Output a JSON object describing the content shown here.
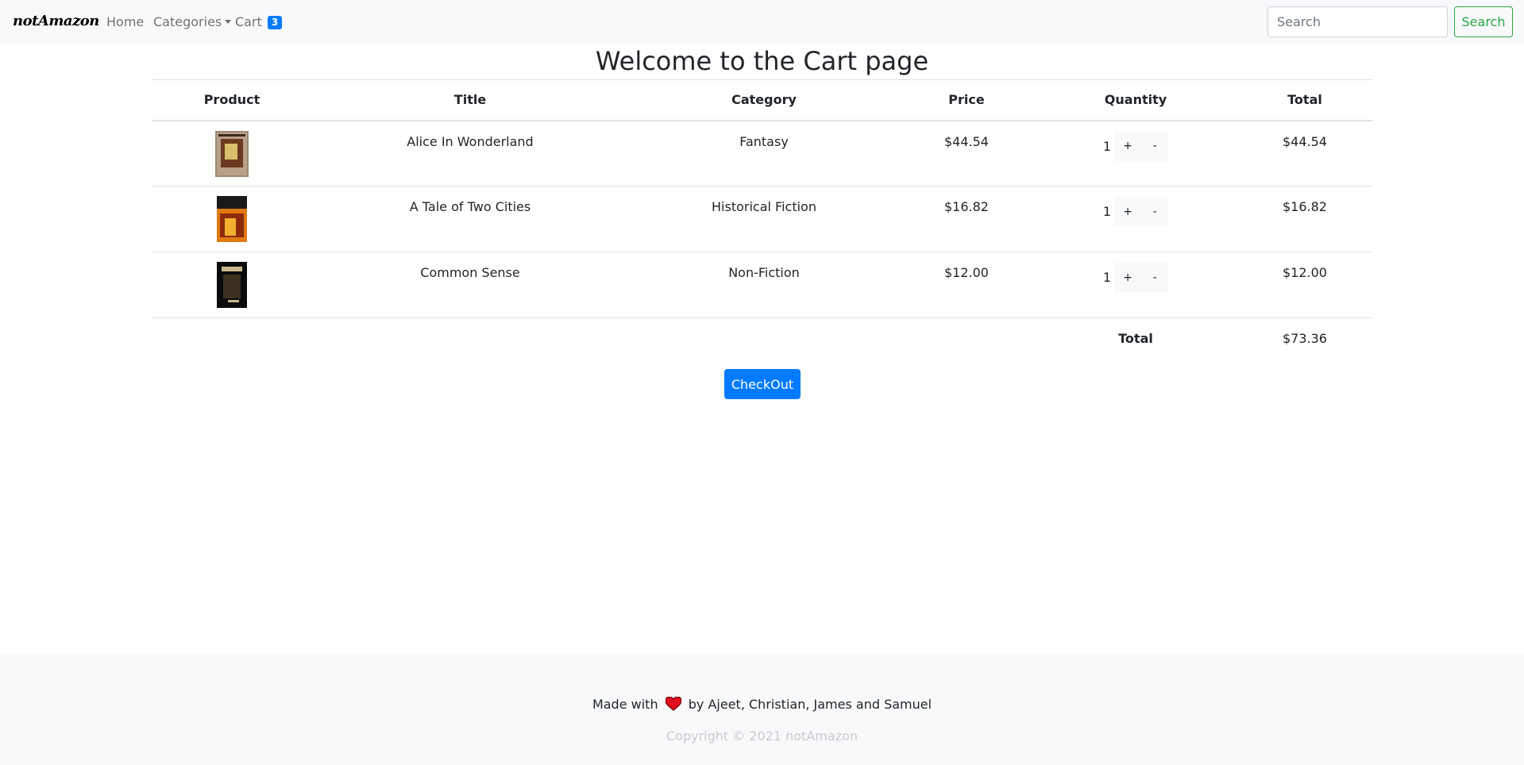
{
  "navbar": {
    "brand": "notAmazon",
    "home": "Home",
    "categories": "Categories",
    "cart": "Cart",
    "cart_count": "3",
    "search_placeholder": "Search",
    "search_button": "Search"
  },
  "main": {
    "title": "Welcome to the Cart page",
    "columns": [
      "Product",
      "Title",
      "Category",
      "Price",
      "Quantity",
      "Total"
    ],
    "rows": [
      {
        "title": "Alice In Wonderland",
        "category": "Fantasy",
        "price": "$44.54",
        "quantity": "1",
        "total": "$44.54"
      },
      {
        "title": "A Tale of Two Cities",
        "category": "Historical Fiction",
        "price": "$16.82",
        "quantity": "1",
        "total": "$16.82"
      },
      {
        "title": "Common Sense",
        "category": "Non-Fiction",
        "price": "$12.00",
        "quantity": "1",
        "total": "$12.00"
      }
    ],
    "increment_label": "+",
    "decrement_label": "-",
    "total_label": "Total",
    "grand_total": "$73.36",
    "checkout_button": "CheckOut"
  },
  "footer": {
    "made_with": "Made with",
    "authors": "by Ajeet, Christian, James and Samuel",
    "copyright": "Copyright © 2021 notAmazon"
  },
  "colors": {
    "primary": "#007bff",
    "success": "#28a745",
    "heart": "#e0101c"
  }
}
